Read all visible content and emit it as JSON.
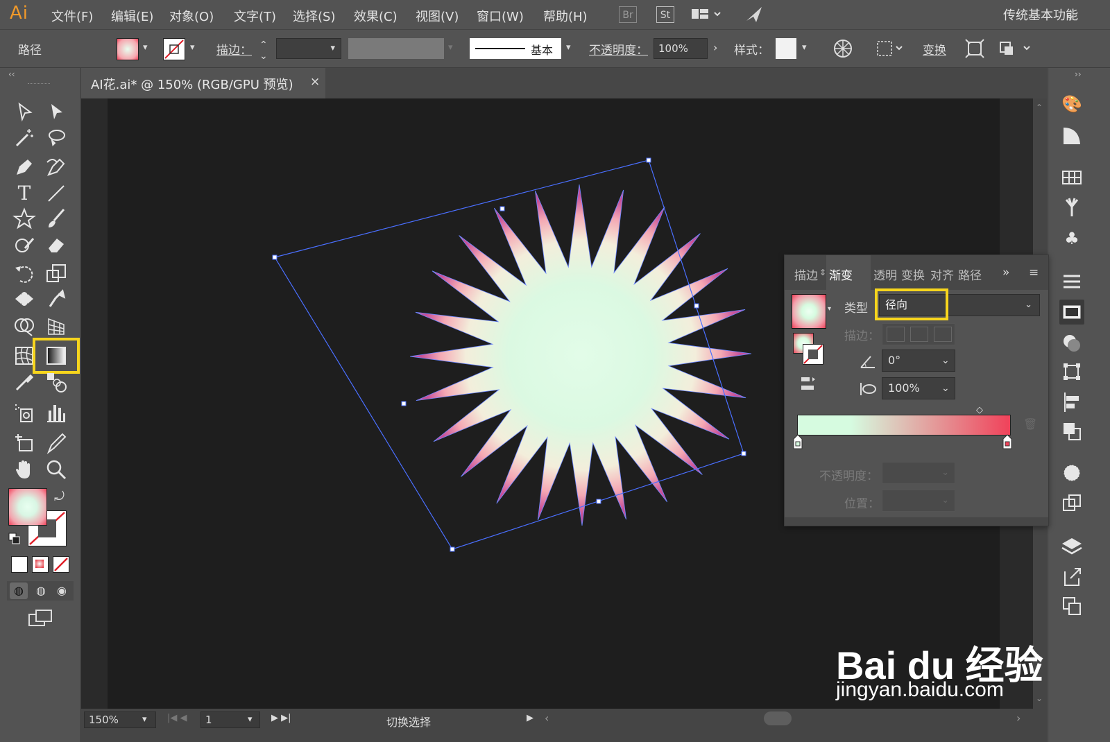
{
  "app": {
    "logo": "Ai"
  },
  "menu": {
    "items": [
      "文件(F)",
      "编辑(E)",
      "对象(O)",
      "文字(T)",
      "选择(S)",
      "效果(C)",
      "视图(V)",
      "窗口(W)",
      "帮助(H)"
    ],
    "icons": [
      "Br",
      "St"
    ],
    "workspace": "传统基本功能"
  },
  "control": {
    "selection_label": "路径",
    "stroke_label": "描边：",
    "stroke_style": "基本",
    "opacity_label": "不透明度：",
    "opacity_value": "100%",
    "style_label": "样式：",
    "transform_label": "变换"
  },
  "document": {
    "tab_title": "AI花.ai* @ 150% (RGB/GPU 预览)",
    "close": "×"
  },
  "status": {
    "zoom": "150%",
    "page": "1",
    "info": "切换选择"
  },
  "gradient_panel": {
    "tabs": [
      "描边",
      "渐变",
      "透明",
      "变换",
      "对齐",
      "路径"
    ],
    "active_tab": "渐变",
    "overflow": "»",
    "type_label": "类型",
    "type_value": "径向",
    "stroke_label": "描边：",
    "angle_value": "0°",
    "ratio_value": "100%",
    "opacity_label": "不透明度：",
    "position_label": "位置：",
    "gradient_start_color": "#d6fbe0",
    "gradient_end_color": "#f0425a"
  },
  "colors": {
    "highlight": "#f7d51d",
    "selection": "#4a7bff",
    "flower_center": "#defbe3",
    "flower_tip": "#f0687c"
  },
  "watermark": {
    "brand": "Bai du 经验",
    "url": "jingyan.baidu.com"
  }
}
